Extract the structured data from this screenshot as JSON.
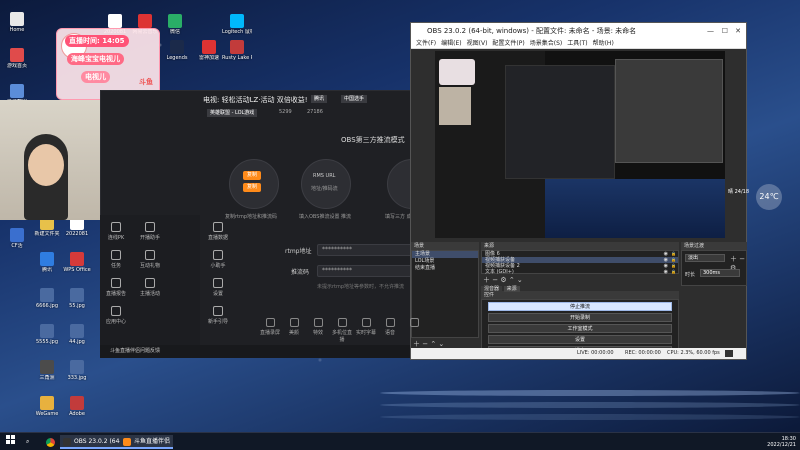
{
  "desktop": {
    "icons_col1": [
      {
        "label": "Home",
        "color": "#e9e9e9"
      },
      {
        "label": "游戏首页",
        "color": "#e04b4b"
      },
      {
        "label": "快速截图",
        "color": "#5b8dd9"
      },
      {
        "label": "Logitech G HUB",
        "color": "#2d2d2d"
      },
      {
        "label": "Origin",
        "color": "#f56c2d"
      },
      {
        "label": "英雄联盟",
        "color": "#c8a24a"
      },
      {
        "label": "CF活",
        "color": "#3a6fcf"
      }
    ],
    "icons_col2": [
      {
        "label": "新建文件夹",
        "color": "#e7c14a"
      },
      {
        "label": "腾讯",
        "color": "#2f7de1"
      },
      {
        "label": "6666.jpg",
        "color": "#4a6aa0"
      },
      {
        "label": "5555.jpg",
        "color": "#4a6aa0"
      },
      {
        "label": "三角洲",
        "color": "#4b4b4b"
      },
      {
        "label": "WeGame",
        "color": "#e8b13e"
      }
    ],
    "icons_col3": [
      {
        "label": "2022081",
        "color": "#ffffff"
      },
      {
        "label": "WPS Office",
        "color": "#d53a3a"
      },
      {
        "label": "55.jpg",
        "color": "#4a6aa0"
      },
      {
        "label": "44.jpg",
        "color": "#4a6aa0"
      },
      {
        "label": "333.jpg",
        "color": "#4a6aa0"
      },
      {
        "label": "Adobe",
        "color": "#c23b3b"
      }
    ],
    "icons_top": [
      {
        "label": "2020081",
        "color": "#ffffff"
      },
      {
        "label": "网易云音乐",
        "color": "#d33"
      },
      {
        "label": "微信",
        "color": "#2aae67"
      },
      {
        "label": "Legends",
        "color": "#1b2a4a"
      },
      {
        "label": "雷神加速",
        "color": "#d33"
      },
      {
        "label": "Rusty Lake Paradise",
        "color": "#c23b3b"
      },
      {
        "label": "Logitech 鼠标设置",
        "color": "#00b8fc"
      }
    ],
    "weather": "24℃",
    "weather_sub": "晴 24/18"
  },
  "live_overlay": {
    "time_label": "直播时间: 14:05",
    "pill2": "海峰宝宝电视儿",
    "pill3": "电视儿",
    "brand": "斗鱼"
  },
  "stream_app": {
    "header_title": "电视: 轻松活动LZ·活动 双倍收益!",
    "header_tag": "腾讯",
    "header_tag2": "中国选手",
    "sub_tag": "英雄联盟 - LOL游戏",
    "sub_count1": "5299",
    "sub_count2": "27186",
    "mode_title": "OBS第三方推流模式",
    "node1_btn": "复制",
    "node1_btn2": "复制",
    "node1_text": "复制rtmp地址和推流码",
    "node2_title": "RMS URL",
    "node2_sub": "地址/推码流",
    "node2_text": "填入OBS推流设置 推流",
    "node3_text": "填写三方 成本高级",
    "rtmp_label": "rtmp地址",
    "rtmp_value": "**********",
    "key_label": "推流码",
    "key_value": "**********",
    "footer_note": "未提示rtmp地址等参数时，不允许推流",
    "side_items": [
      "连线PK",
      "开播助手",
      "",
      "直播数据",
      "任务",
      "互动礼物",
      "",
      "小助手",
      "直播报告",
      "主播活动",
      "",
      "设置",
      "应用中心",
      "",
      "",
      "新手引导"
    ],
    "side_title": "直播助手",
    "side_label2": "互动玩法",
    "bottom_tools": [
      "直播录屏",
      "美颜",
      "特效",
      "多机位直播",
      "实时字幕",
      "语音",
      ""
    ],
    "bottom_label": "斗鱼直播伴侣问题反馈"
  },
  "obs": {
    "title": "OBS 23.0.2 (64-bit, windows) - 配置文件: 未命名 - 场景: 未命名",
    "menu": [
      "文件(F)",
      "编辑(E)",
      "视图(V)",
      "配置文件(P)",
      "场景集合(S)",
      "工具(T)",
      "帮助(H)"
    ],
    "scenes_header": "场景",
    "scenes": [
      "主场景",
      "LOL场景",
      "结束直播"
    ],
    "sources_header": "来源",
    "sources": [
      "图像 6",
      "视频捕获设备",
      "视频捕获设备 2",
      "文本 (GDI+)"
    ],
    "mixer_header": "混音器",
    "transitions_header": "场景过渡",
    "transition_type": "淡出",
    "duration_label": "时长",
    "duration_value": "300ms",
    "mixer_tab1": "混音器",
    "mixer_tab2": "来源",
    "controls_header": "控件",
    "controls": [
      "停止推流",
      "开始录制",
      "工作室模式",
      "设置",
      "退出"
    ],
    "status": {
      "live": "LIVE: 00:00:00",
      "rec": "REC: 00:00:00",
      "cpu": "CPU: 2.3%, 60.00 fps"
    }
  },
  "taskbar": {
    "apps": [
      {
        "label": "OBS 23.0.2 (64-bi...",
        "color": "#333"
      },
      {
        "label": "斗鱼直播伴侣",
        "color": "#ff8b1a"
      }
    ],
    "time": "18:30",
    "date": "2022/12/21"
  }
}
